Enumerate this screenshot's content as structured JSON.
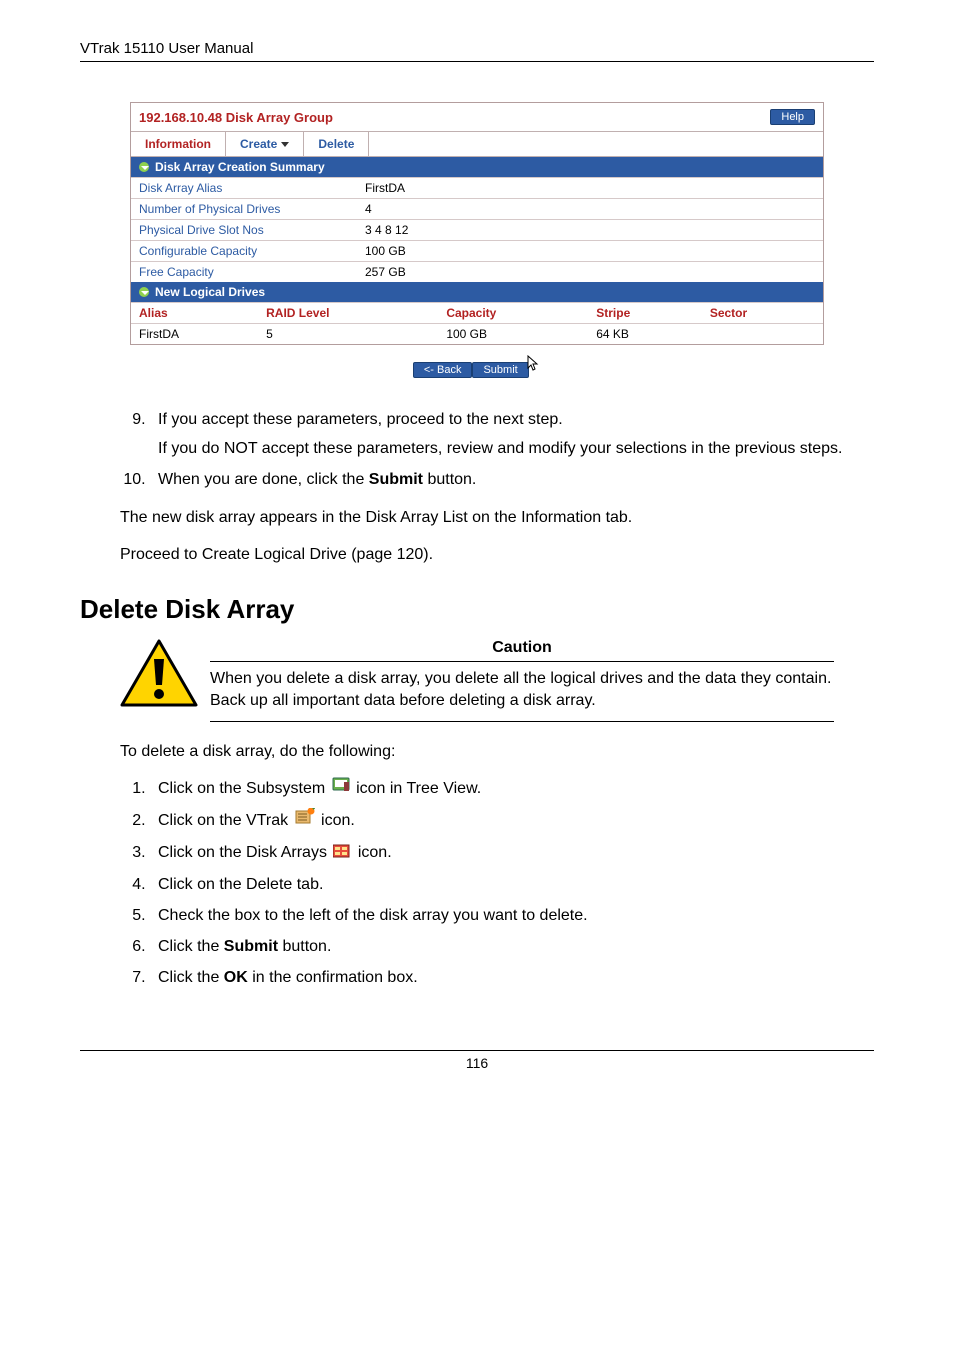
{
  "header": {
    "manual_title": "VTrak 15110 User Manual"
  },
  "ui": {
    "title": "192.168.10.48 Disk Array Group",
    "help_label": "Help",
    "tabs": {
      "information": "Information",
      "create": "Create",
      "delete": "Delete"
    },
    "section1": "Disk Array Creation Summary",
    "kv": [
      {
        "k": "Disk Array Alias",
        "v": "FirstDA"
      },
      {
        "k": "Number of Physical Drives",
        "v": "4"
      },
      {
        "k": "Physical Drive Slot Nos",
        "v": "3  4  8  12"
      },
      {
        "k": "Configurable Capacity",
        "v": "100 GB"
      },
      {
        "k": "Free Capacity",
        "v": "257 GB"
      }
    ],
    "section2": "New Logical Drives",
    "grid": {
      "headers": [
        "Alias",
        "RAID Level",
        "Capacity",
        "Stripe",
        "Sector"
      ],
      "row": [
        "FirstDA",
        "5",
        "100 GB",
        "64 KB",
        ""
      ]
    },
    "buttons": {
      "back": "<- Back",
      "submit": "Submit"
    }
  },
  "steps_a": {
    "start": 9,
    "items": [
      {
        "main": "If you accept these parameters, proceed to the next step.",
        "sub": "If you do NOT accept these parameters, review and modify your selections in the previous steps."
      },
      {
        "main_pre": "When you are done, click the ",
        "main_bold": "Submit",
        "main_post": " button."
      }
    ]
  },
  "para1": "The new disk array appears in the Disk Array List on the Information tab.",
  "para2": "Proceed to Create Logical Drive (page 120).",
  "h2": "Delete Disk Array",
  "caution": {
    "title": "Caution",
    "body": "When you delete a disk array, you delete all the logical drives and the data they contain. Back up all important data before deleting a disk array."
  },
  "para3": "To delete a disk array, do the following:",
  "steps_b": [
    {
      "pre": "Click on the Subsystem ",
      "icon": "subsystem",
      "post": " icon in Tree View."
    },
    {
      "pre": "Click on the VTrak ",
      "icon": "vtrak",
      "post": " icon."
    },
    {
      "pre": "Click on the Disk Arrays ",
      "icon": "diskarrays",
      "post": " icon."
    },
    {
      "pre": "Click on the Delete tab.",
      "icon": null,
      "post": ""
    },
    {
      "pre": "Check the box to the left of the disk array you want to delete.",
      "icon": null,
      "post": ""
    },
    {
      "pre": "Click the ",
      "bold": "Submit",
      "post": " button."
    },
    {
      "pre": "Click the ",
      "bold": "OK",
      "post": " in the confirmation box."
    }
  ],
  "footer": {
    "page": "116"
  }
}
